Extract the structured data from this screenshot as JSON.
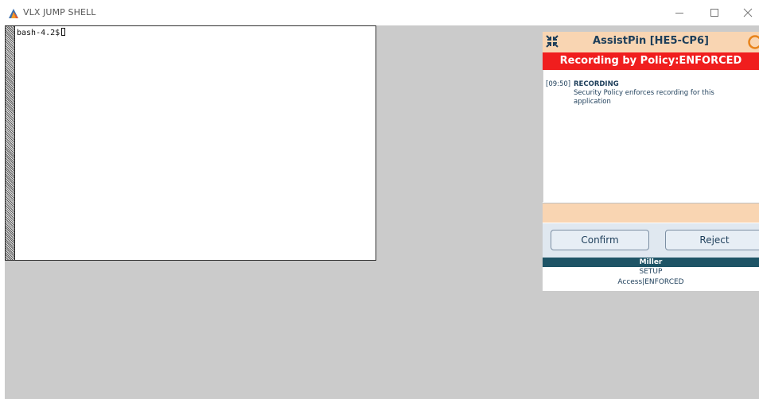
{
  "window": {
    "title": "VLX JUMP SHELL",
    "controls": {
      "minimize": "—",
      "maximize": "☐",
      "close": "✕"
    }
  },
  "terminal": {
    "prompt": "bash-4.2$"
  },
  "assistpin": {
    "title": "AssistPin [HE5-CP6]",
    "banner": "Recording by Policy:ENFORCED",
    "log": {
      "time": "[09:50]",
      "heading": "RECORDING",
      "message": "Security Policy enforces recording for this application"
    },
    "buttons": {
      "confirm": "Confirm",
      "reject": "Reject"
    },
    "user": "Miller",
    "mode": "SETUP",
    "access": "Access|ENFORCED"
  },
  "colors": {
    "accent_peach": "#f9d5b2",
    "banner_red": "#f01e1e",
    "user_bar": "#1e5466",
    "text_navy": "#1d3e5a",
    "workspace_gray": "#cbcbcb"
  },
  "icons": [
    "app-logo-icon",
    "shrink-arrows-icon",
    "status-ring-icon",
    "minimize-icon",
    "maximize-icon",
    "close-icon"
  ]
}
